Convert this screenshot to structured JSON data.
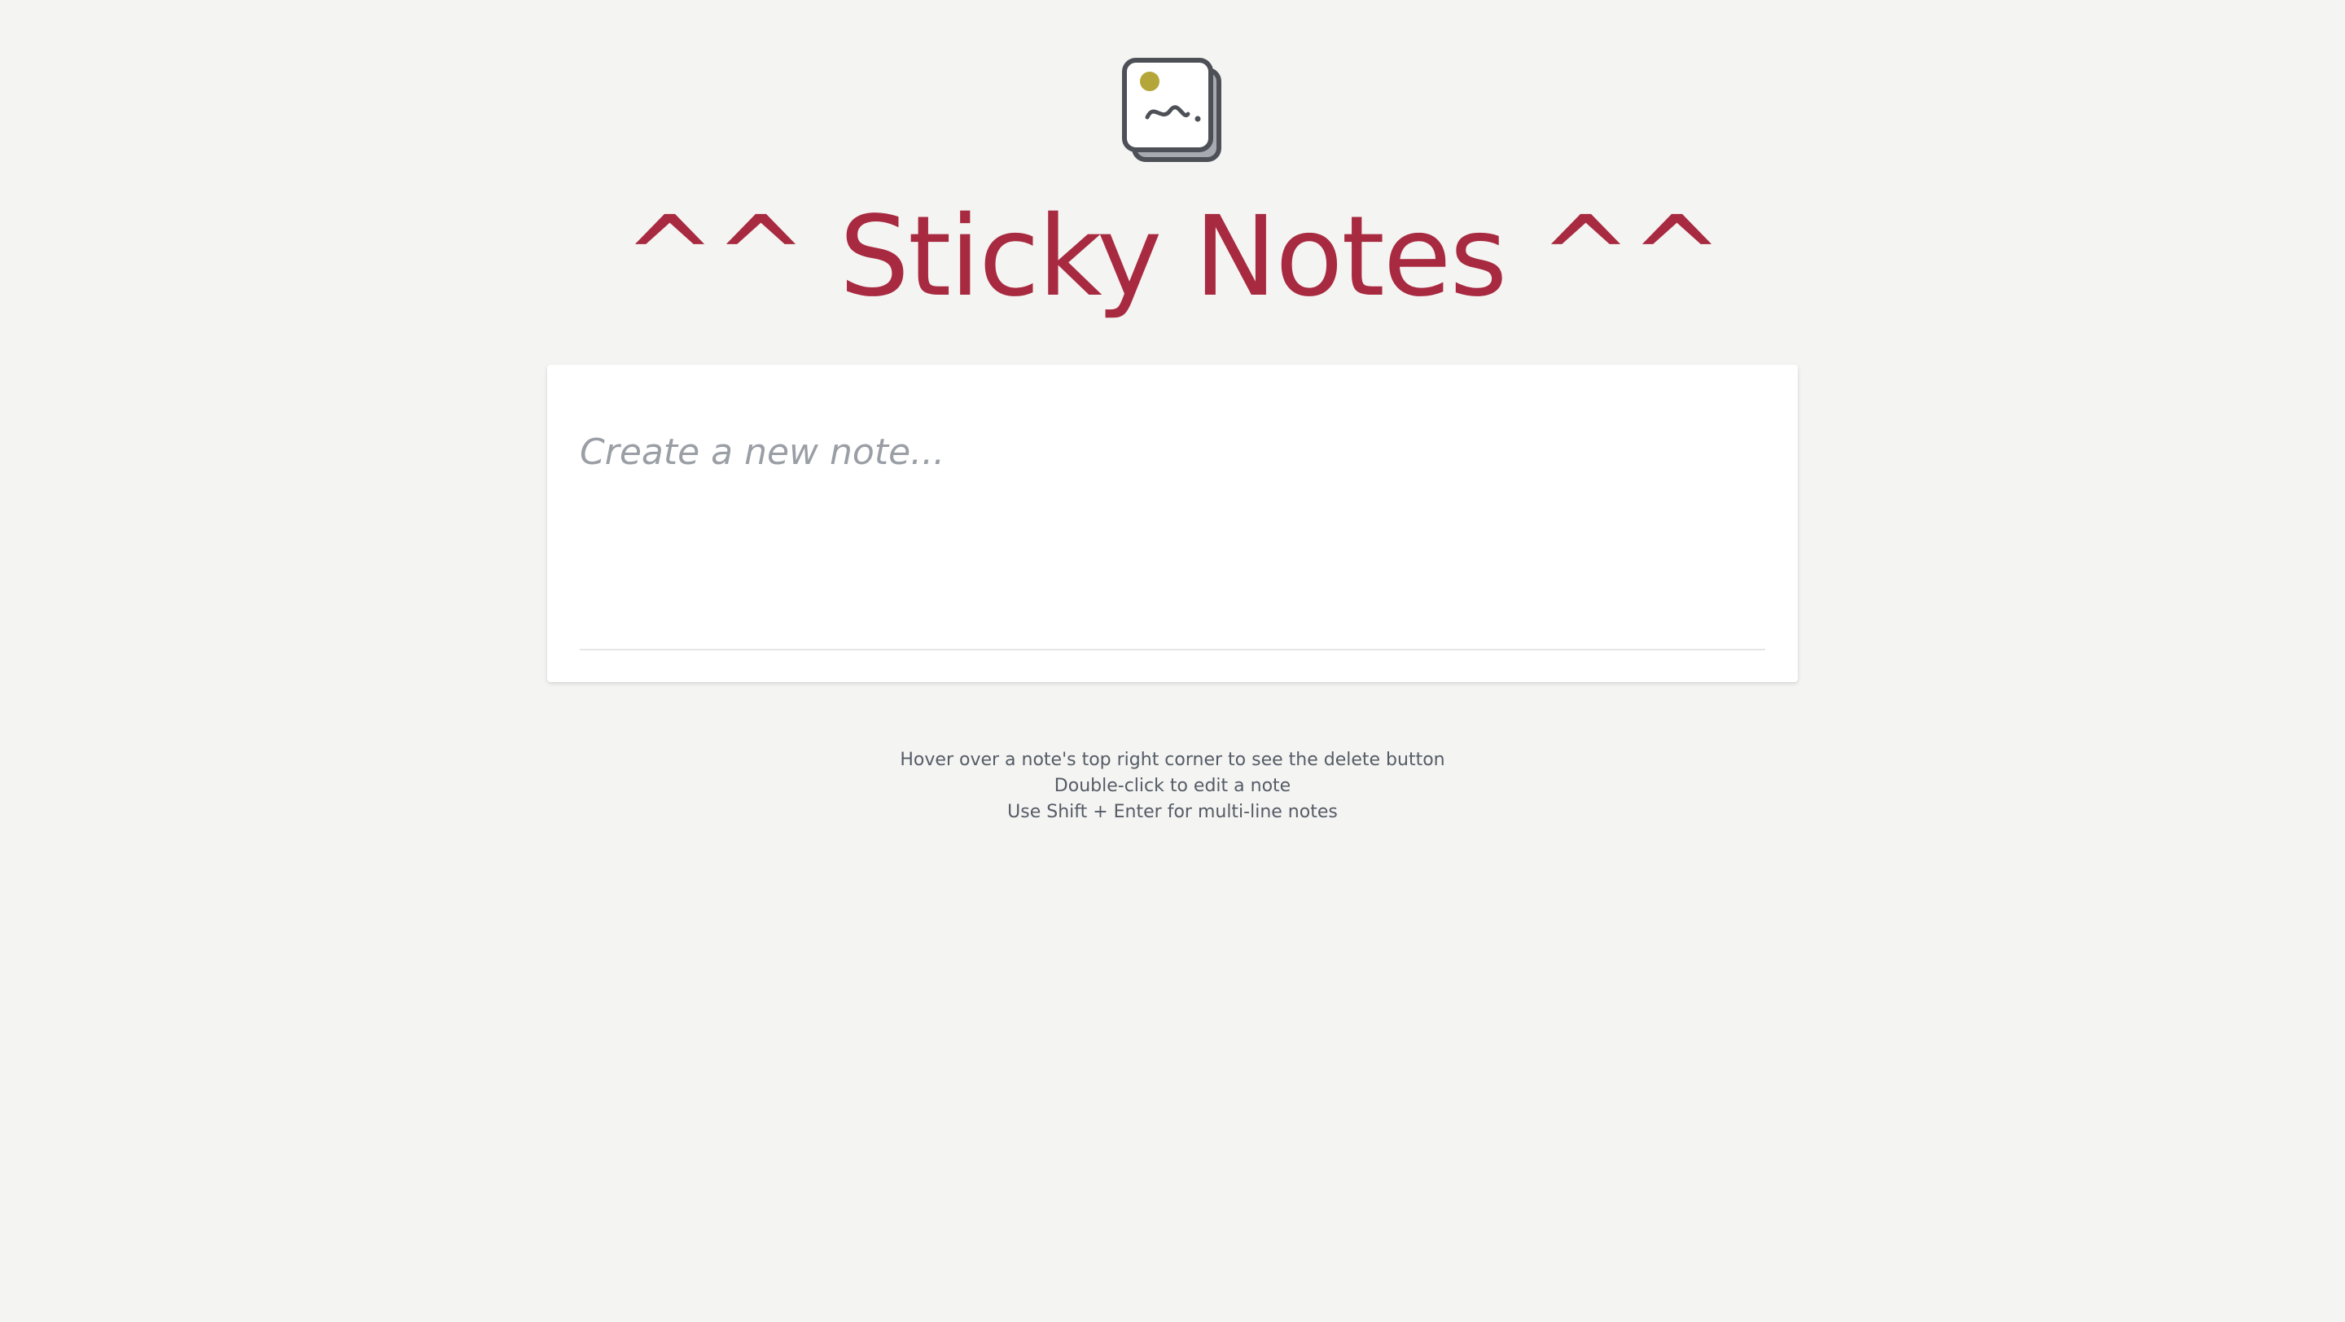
{
  "header": {
    "logo_icon": "sticky-note-icon",
    "title": "^^ Sticky Notes ^^"
  },
  "editor": {
    "placeholder": "Create a new note...",
    "value": ""
  },
  "tips": [
    "Hover over a note's top right corner to see the delete button",
    "Double-click to edit a note",
    "Use Shift + Enter for multi-line notes"
  ],
  "colors": {
    "background": "#f4f4f2",
    "title": "#a82a40",
    "card": "#ffffff",
    "placeholder": "#9a9ea5",
    "tip_text": "#555c66",
    "logo_dot": "#b5a63a",
    "logo_outline": "#4d5157"
  }
}
